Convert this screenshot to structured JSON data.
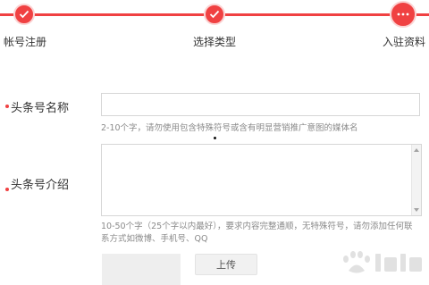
{
  "stepper": {
    "steps": [
      {
        "label": "帐号注册",
        "status": "done"
      },
      {
        "label": "选择类型",
        "status": "done"
      },
      {
        "label": "入驻资料",
        "status": "active"
      }
    ],
    "accent_color": "#f04142"
  },
  "form": {
    "name_field": {
      "label": "头条号名称",
      "value": "",
      "hint": "2-10个字，请勿使用包含特殊符号或含有明显营销推广意图的媒体名"
    },
    "intro_field": {
      "label": "头条号介绍",
      "value": "",
      "hint_line1": "10-50个字（25个字以内最好），要求内容完整通顺，无特殊符号，请勿添加任何联",
      "hint_line2": "系方式如微博、手机号、QQ"
    },
    "upload_button_label": "上传"
  },
  "watermark": {
    "icons": [
      "baidu-paw-icon"
    ]
  }
}
